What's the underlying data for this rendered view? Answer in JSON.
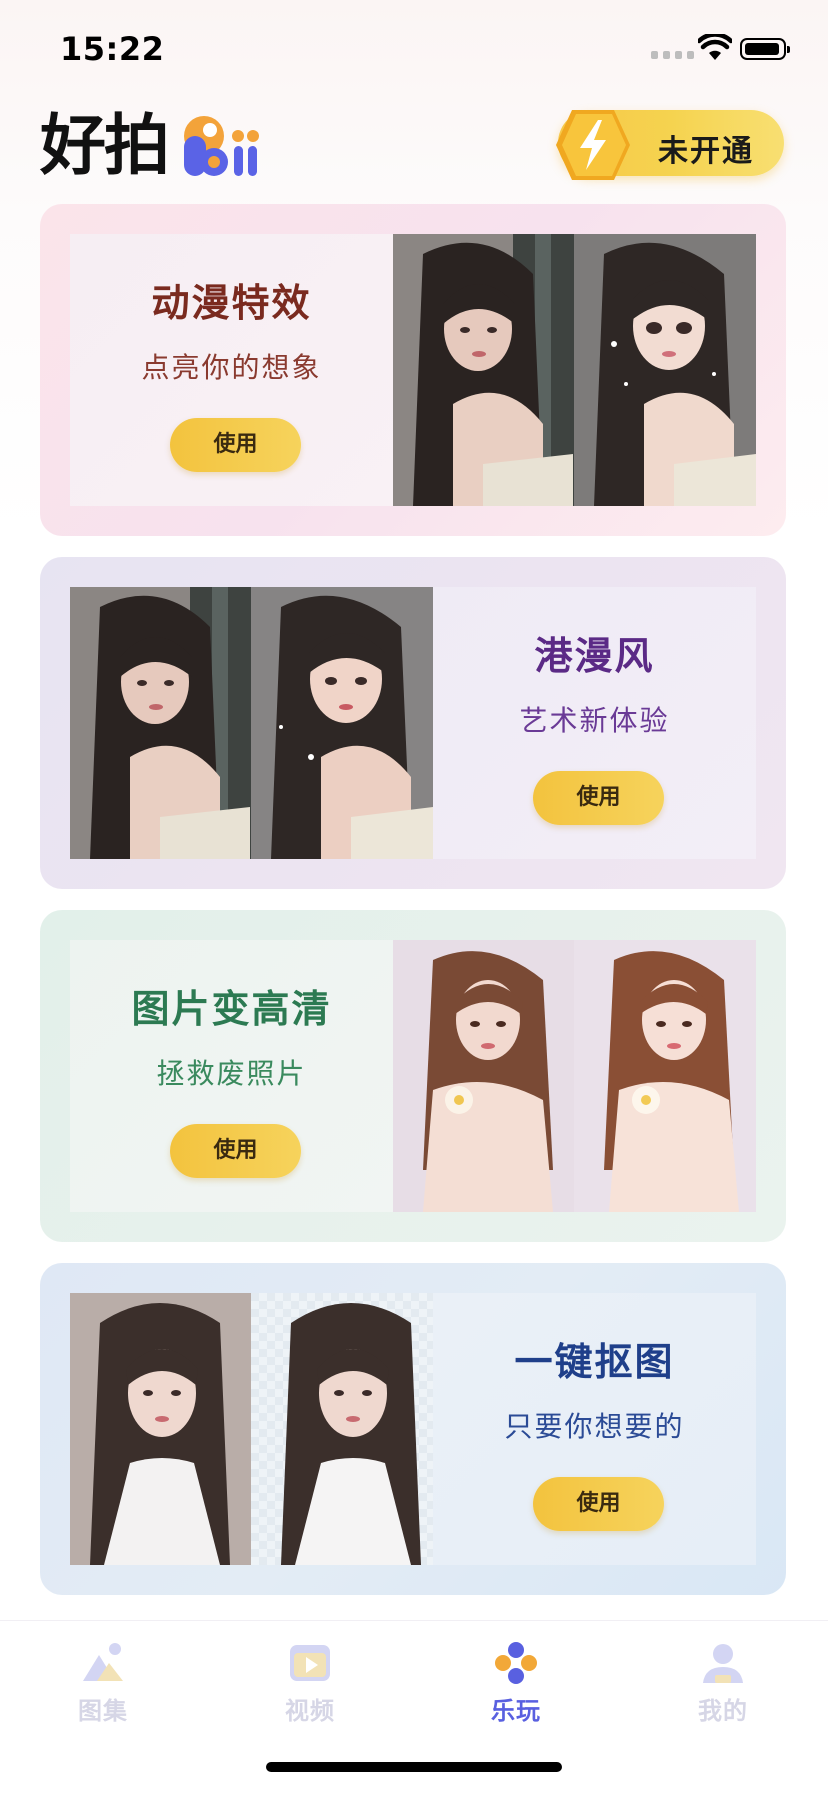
{
  "status_bar": {
    "time": "15:22"
  },
  "header": {
    "logo_text": "好拍",
    "logo_suffix": "Pai",
    "vip_label": "未开通",
    "accent": "#f5c842"
  },
  "cards": [
    {
      "title": "动漫特效",
      "subtitle": "点亮你的想象",
      "button": "使用",
      "title_color": "#7a2a1f",
      "sub_color": "#8a3a2f"
    },
    {
      "title": "港漫风",
      "subtitle": "艺术新体验",
      "button": "使用",
      "title_color": "#5b2a86",
      "sub_color": "#6a3a96"
    },
    {
      "title": "图片变高清",
      "subtitle": "拯救废照片",
      "button": "使用",
      "title_color": "#2c7a52",
      "sub_color": "#3a8a5e"
    },
    {
      "title": "一键抠图",
      "subtitle": "只要你想要的",
      "button": "使用",
      "title_color": "#1f3f8a",
      "sub_color": "#2b4b96"
    }
  ],
  "tabbar": {
    "tabs": [
      {
        "label": "图集",
        "icon": "gallery-icon",
        "active": false
      },
      {
        "label": "视频",
        "icon": "video-icon",
        "active": false
      },
      {
        "label": "乐玩",
        "icon": "play-icon",
        "active": true
      },
      {
        "label": "我的",
        "icon": "profile-icon",
        "active": false
      }
    ],
    "active_color": "#5960e0",
    "inactive_color": "#d6d6e6"
  }
}
